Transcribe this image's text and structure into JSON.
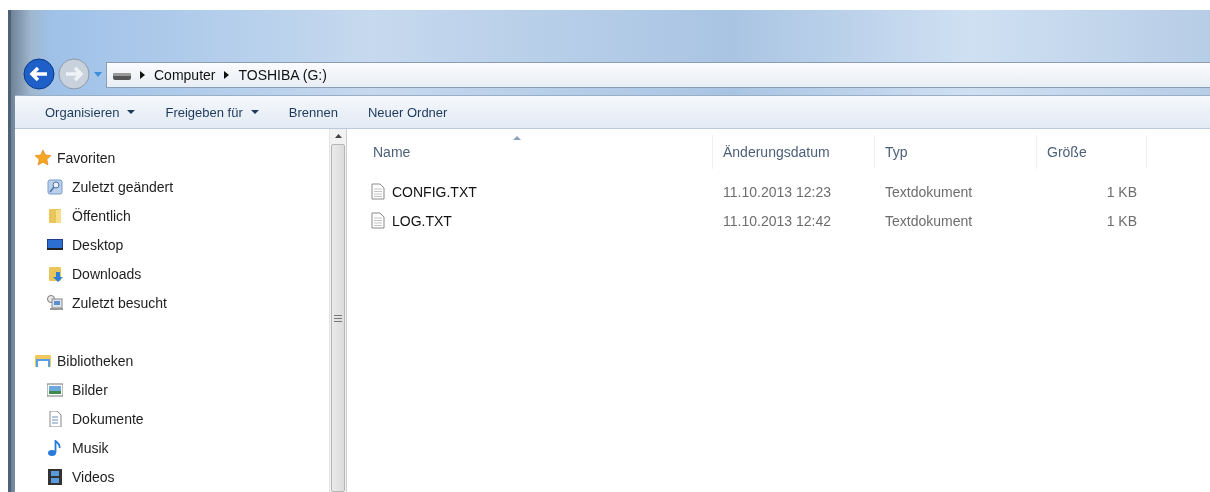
{
  "address_bar": {
    "segments": [
      "Computer",
      "TOSHIBA (G:)"
    ]
  },
  "toolbar": [
    {
      "label": "Organisieren",
      "dropdown": true
    },
    {
      "label": "Freigeben für",
      "dropdown": true
    },
    {
      "label": "Brennen",
      "dropdown": false
    },
    {
      "label": "Neuer Ordner",
      "dropdown": false
    }
  ],
  "sidebar": {
    "groups": [
      {
        "label": "Favoriten",
        "kind": "star",
        "children": [
          {
            "label": "Zuletzt geändert",
            "kind": "recent"
          },
          {
            "label": "Öffentlich",
            "kind": "folder"
          },
          {
            "label": "Desktop",
            "kind": "desktop"
          },
          {
            "label": "Downloads",
            "kind": "downloads"
          },
          {
            "label": "Zuletzt besucht",
            "kind": "places"
          }
        ]
      },
      {
        "label": "Bibliotheken",
        "kind": "library",
        "children": [
          {
            "label": "Bilder",
            "kind": "pictures"
          },
          {
            "label": "Dokumente",
            "kind": "documents"
          },
          {
            "label": "Musik",
            "kind": "music"
          },
          {
            "label": "Videos",
            "kind": "videos"
          }
        ]
      }
    ]
  },
  "table": {
    "columns": [
      {
        "label": "Name",
        "sorted": true
      },
      {
        "label": "Änderungsdatum",
        "sorted": false
      },
      {
        "label": "Typ",
        "sorted": false
      },
      {
        "label": "Größe",
        "sorted": false
      }
    ],
    "rows": [
      {
        "name": "CONFIG.TXT",
        "date": "11.10.2013 12:23",
        "type": "Textdokument",
        "size": "1 KB"
      },
      {
        "name": "LOG.TXT",
        "date": "11.10.2013 12:42",
        "type": "Textdokument",
        "size": "1 KB"
      }
    ]
  }
}
